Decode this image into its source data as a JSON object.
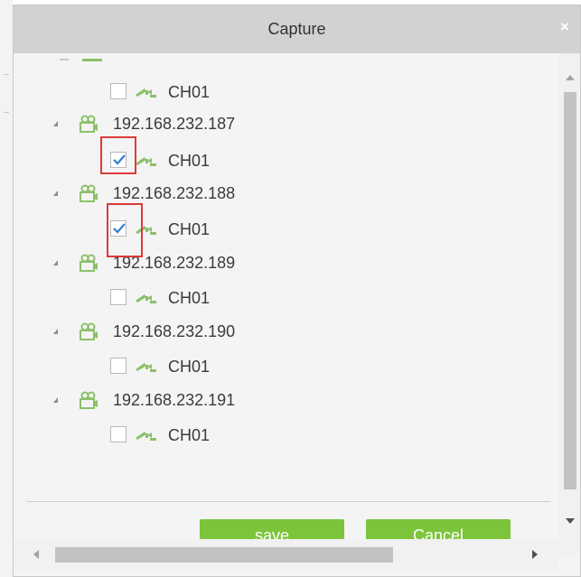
{
  "dialog": {
    "title": "Capture",
    "close_label": "×"
  },
  "tree": {
    "devices": [
      {
        "ip": "192.168.232.187",
        "channel": "CH01",
        "checked": true
      },
      {
        "ip": "192.168.232.188",
        "channel": "CH01",
        "checked": true
      },
      {
        "ip": "192.168.232.189",
        "channel": "CH01",
        "checked": false
      },
      {
        "ip": "192.168.232.190",
        "channel": "CH01",
        "checked": false
      },
      {
        "ip": "192.168.232.191",
        "channel": "CH01",
        "checked": false
      }
    ],
    "top_partial_channel": {
      "channel": "CH01",
      "checked": false
    }
  },
  "buttons": {
    "save_label": "save",
    "cancel_label": "Cancel"
  },
  "colors": {
    "accent_green": "#7cc53b",
    "icon_green": "#8cc06a",
    "highlight_red": "#dd3a3a",
    "check_blue": "#2f7fd0"
  },
  "icons": {
    "device": "video-device-icon",
    "channel": "camera-icon",
    "expander": "tree-expander-icon",
    "close": "close-icon"
  }
}
